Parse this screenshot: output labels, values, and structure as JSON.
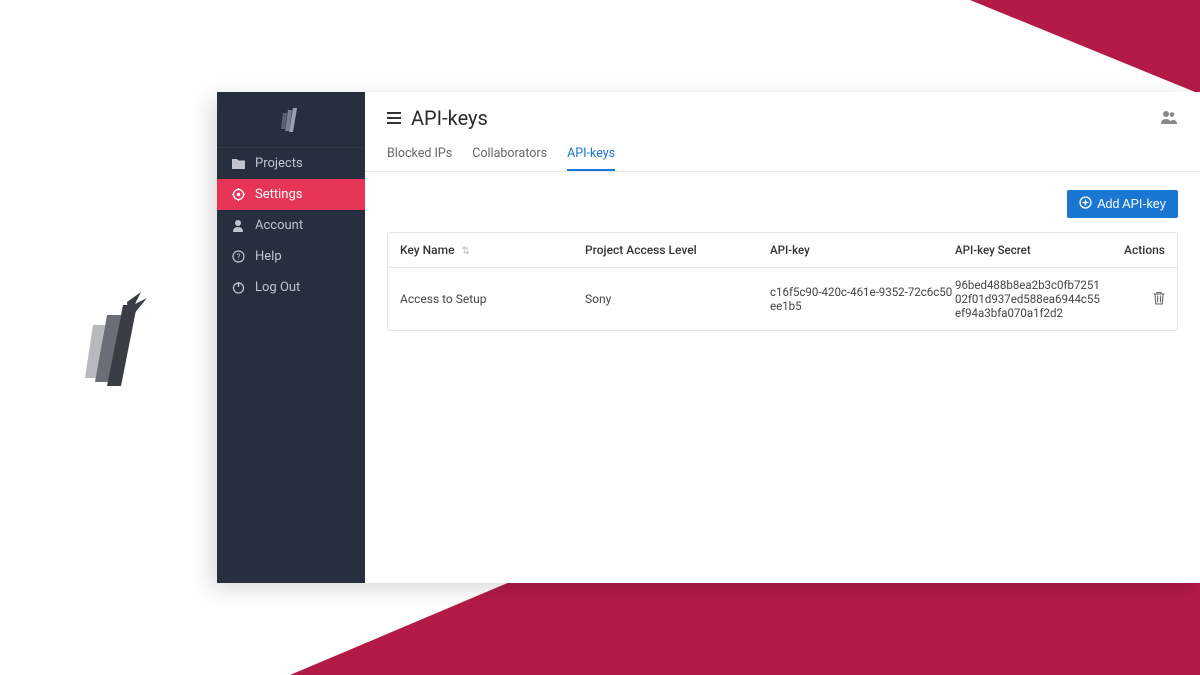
{
  "colors": {
    "brand_bg": "#b31b46",
    "sidebar_bg": "#272e3d",
    "accent": "#e73558",
    "primary": "#1976d2"
  },
  "sidebar": {
    "items": [
      {
        "label": "Projects",
        "icon": "folder"
      },
      {
        "label": "Settings",
        "icon": "gear",
        "active": true
      },
      {
        "label": "Account",
        "icon": "user"
      },
      {
        "label": "Help",
        "icon": "help"
      },
      {
        "label": "Log Out",
        "icon": "power"
      }
    ]
  },
  "page": {
    "title": "API-keys"
  },
  "tabs": [
    {
      "label": "Blocked IPs"
    },
    {
      "label": "Collaborators"
    },
    {
      "label": "API-keys",
      "active": true
    }
  ],
  "toolbar": {
    "add_label": "Add API-key"
  },
  "table": {
    "columns": {
      "name": "Key Name",
      "level": "Project Access Level",
      "key": "API-key",
      "secret": "API-key Secret",
      "actions": "Actions"
    },
    "rows": [
      {
        "name": "Access to Setup",
        "level": "Sony",
        "key": "c16f5c90-420c-461e-9352-72c6c50ee1b5",
        "secret": "96bed488b8ea2b3c0fb725102f01d937ed588ea6944c55ef94a3bfa070a1f2d2"
      }
    ]
  }
}
